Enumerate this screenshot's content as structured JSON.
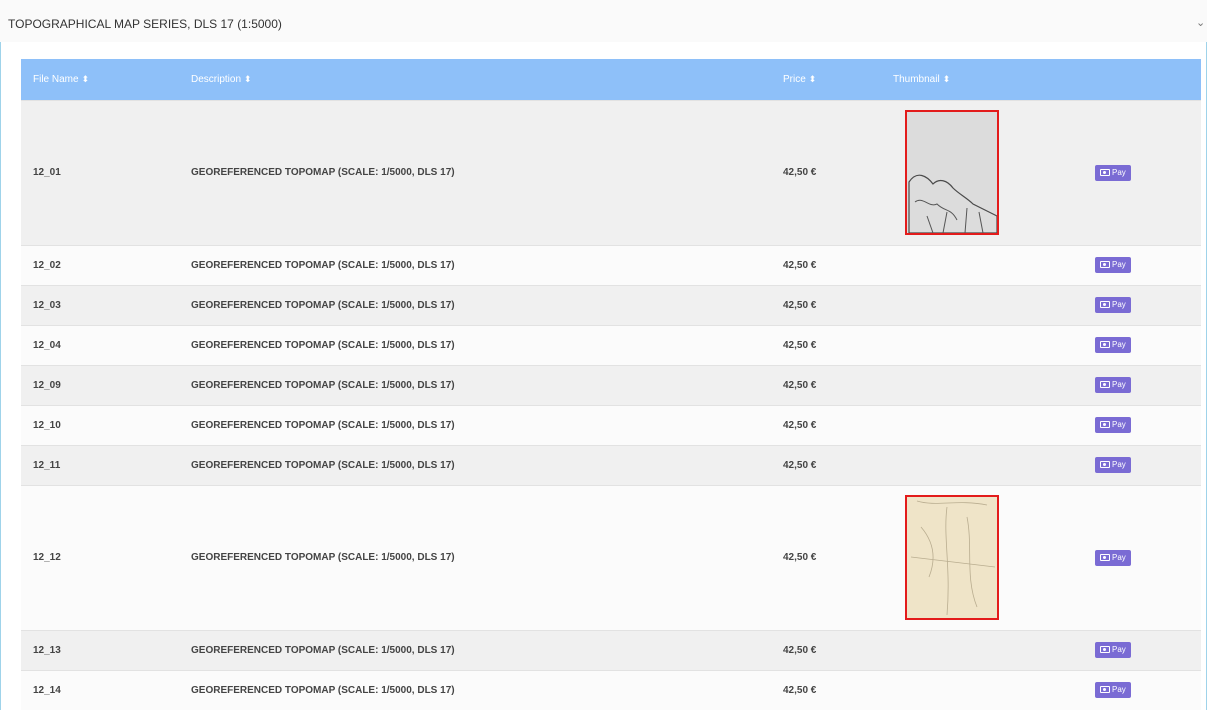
{
  "panel": {
    "title": "TOPOGRAPHICAL MAP SERIES, DLS 17 (1:5000)",
    "collapse_icon": "chevron-down-icon"
  },
  "table": {
    "headers": {
      "file_name": "File Name",
      "description": "Description",
      "price": "Price",
      "thumbnail": "Thumbnail",
      "sort_icon": "⬍"
    },
    "pay_label": "Pay",
    "rows": [
      {
        "file": "12_01",
        "description": "GEOREFERENCED TOPOMAP (SCALE: 1/5000, DLS 17)",
        "price": "42,50 €",
        "thumbnail": "grey"
      },
      {
        "file": "12_02",
        "description": "GEOREFERENCED TOPOMAP (SCALE: 1/5000, DLS 17)",
        "price": "42,50 €",
        "thumbnail": ""
      },
      {
        "file": "12_03",
        "description": "GEOREFERENCED TOPOMAP (SCALE: 1/5000, DLS 17)",
        "price": "42,50 €",
        "thumbnail": ""
      },
      {
        "file": "12_04",
        "description": "GEOREFERENCED TOPOMAP (SCALE: 1/5000, DLS 17)",
        "price": "42,50 €",
        "thumbnail": ""
      },
      {
        "file": "12_09",
        "description": "GEOREFERENCED TOPOMAP (SCALE: 1/5000, DLS 17)",
        "price": "42,50 €",
        "thumbnail": ""
      },
      {
        "file": "12_10",
        "description": "GEOREFERENCED TOPOMAP (SCALE: 1/5000, DLS 17)",
        "price": "42,50 €",
        "thumbnail": ""
      },
      {
        "file": "12_11",
        "description": "GEOREFERENCED TOPOMAP (SCALE: 1/5000, DLS 17)",
        "price": "42,50 €",
        "thumbnail": ""
      },
      {
        "file": "12_12",
        "description": "GEOREFERENCED TOPOMAP (SCALE: 1/5000, DLS 17)",
        "price": "42,50 €",
        "thumbnail": "beige"
      },
      {
        "file": "12_13",
        "description": "GEOREFERENCED TOPOMAP (SCALE: 1/5000, DLS 17)",
        "price": "42,50 €",
        "thumbnail": ""
      },
      {
        "file": "12_14",
        "description": "GEOREFERENCED TOPOMAP (SCALE: 1/5000, DLS 17)",
        "price": "42,50 €",
        "thumbnail": ""
      }
    ]
  },
  "colors": {
    "header_bg": "#8ec0f9",
    "pay_button": "#7a6bd4",
    "thumbnail_border": "#e31b1b"
  }
}
